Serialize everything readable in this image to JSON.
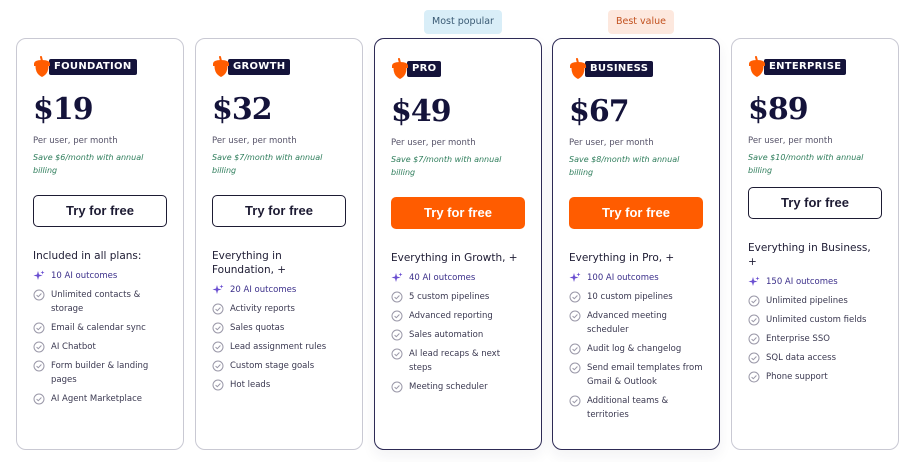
{
  "badges": {
    "popular": "Most popular",
    "value": "Best value"
  },
  "plans": [
    {
      "name": "FOUNDATION",
      "price": "$19",
      "per": "Per user, per month",
      "save": "Save $6/month with annual billing",
      "cta": "Try for free",
      "included": "Included in all plans:",
      "features": [
        "10 AI outcomes",
        "Unlimited contacts & storage",
        "Email & calendar sync",
        "AI Chatbot",
        "Form builder & landing pages",
        "AI Agent Marketplace"
      ]
    },
    {
      "name": "GROWTH",
      "price": "$32",
      "per": "Per user, per month",
      "save": "Save $7/month with annual billing",
      "cta": "Try for free",
      "included": "Everything in Foundation, +",
      "features": [
        "20 AI outcomes",
        "Activity reports",
        "Sales quotas",
        "Lead assignment rules",
        "Custom stage goals",
        "Hot leads"
      ]
    },
    {
      "name": "PRO",
      "price": "$49",
      "per": "Per user, per month",
      "save": "Save $7/month with annual billing",
      "cta": "Try for free",
      "included": "Everything in Growth, +",
      "features": [
        "40 AI outcomes",
        "5 custom pipelines",
        "Advanced reporting",
        "Sales automation",
        "AI lead recaps & next steps",
        "Meeting scheduler"
      ]
    },
    {
      "name": "BUSINESS",
      "price": "$67",
      "per": "Per user, per month",
      "save": "Save $8/month with annual billing",
      "cta": "Try for free",
      "included": "Everything in Pro, +",
      "features": [
        "100 AI outcomes",
        "10 custom pipelines",
        "Advanced meeting scheduler",
        "Audit log & changelog",
        "Send email templates from Gmail & Outlook",
        "Additional teams & territories"
      ]
    },
    {
      "name": "ENTERPRISE",
      "price": "$89",
      "per": "Per user, per month",
      "save": "Save $10/month with annual billing",
      "cta": "Try for free",
      "included": "Everything in Business, +",
      "features": [
        "150 AI outcomes",
        "Unlimited pipelines",
        "Unlimited custom fields",
        "Enterprise SSO",
        "SQL data access",
        "Phone support"
      ]
    }
  ],
  "colors": {
    "accent": "#ff5c00",
    "navy": "#14133a",
    "save_green": "#2e7d5b",
    "ai_purple": "#6a4fd1"
  },
  "icons": {
    "plan": "acorn-icon",
    "ai": "sparkle-icon",
    "check": "check-circle-icon"
  }
}
